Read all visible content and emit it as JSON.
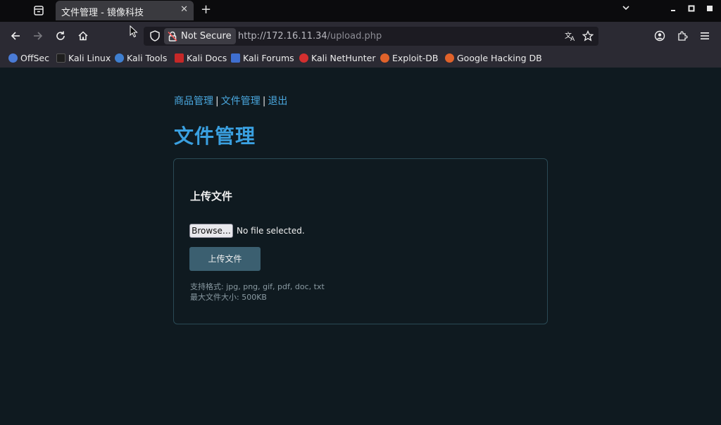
{
  "browser": {
    "tab_title": "文件管理 - 镜像科技",
    "tab_close": "✕",
    "new_tab": "+",
    "security_label": "Not Secure",
    "url_host": "http://172.16.11.34",
    "url_path": "/upload.php"
  },
  "bookmarks": [
    {
      "label": "OffSec",
      "icon": "offsec-icon",
      "color": "#4a7bd6"
    },
    {
      "label": "Kali Linux",
      "icon": "kali-dragon-icon",
      "color": "#1e1e1e"
    },
    {
      "label": "Kali Tools",
      "icon": "kali-tools-icon",
      "color": "#3f7fd0"
    },
    {
      "label": "Kali Docs",
      "icon": "kali-docs-icon",
      "color": "#c62828"
    },
    {
      "label": "Kali Forums",
      "icon": "kali-forums-icon",
      "color": "#3f6fd0"
    },
    {
      "label": "Kali NetHunter",
      "icon": "nethunter-icon",
      "color": "#d32f2f"
    },
    {
      "label": "Exploit-DB",
      "icon": "exploit-db-icon",
      "color": "#e0622a"
    },
    {
      "label": "Google Hacking DB",
      "icon": "ghdb-icon",
      "color": "#e0622a"
    }
  ],
  "page": {
    "nav": {
      "products": "商品管理",
      "separator": "|",
      "files": "文件管理",
      "logout": "退出"
    },
    "title": "文件管理",
    "card": {
      "title": "上传文件",
      "browse_label": "Browse…",
      "file_status": "No file selected.",
      "upload_button": "上传文件",
      "hint_formats": "支持格式: jpg, png, gif, pdf, doc, txt",
      "hint_size": "最大文件大小: 500KB"
    }
  },
  "colors": {
    "page_bg": "#0f1a20",
    "accent": "#3aa0e0",
    "button": "#3b5f70",
    "card_border": "#2a4a55"
  }
}
